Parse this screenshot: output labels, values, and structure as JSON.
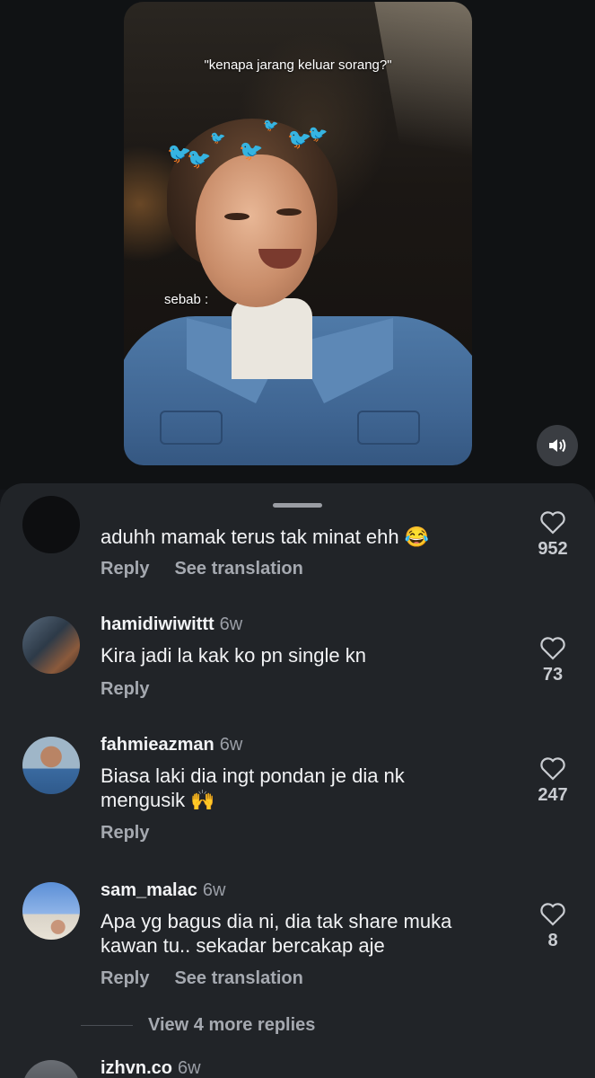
{
  "video": {
    "caption_top": "\"kenapa jarang keluar sorang?\"",
    "caption_mid": "sebab :",
    "mute_icon": "speaker-volume-icon"
  },
  "comments_sheet": {
    "comments": [
      {
        "text": "aduhh mamak terus tak minat ehh 😂",
        "reply_label": "Reply",
        "translate_label": "See translation",
        "likes": "952"
      },
      {
        "username": "hamidiwiwittt",
        "time": "6w",
        "text": "Kira jadi la kak ko pn single kn",
        "reply_label": "Reply",
        "likes": "73"
      },
      {
        "username": "fahmieazman",
        "time": "6w",
        "text": "Biasa laki dia ingt pondan je dia nk mengusik 🙌",
        "reply_label": "Reply",
        "likes": "247"
      },
      {
        "username": "sam_malac",
        "time": "6w",
        "text": "Apa yg bagus dia ni, dia tak share muka kawan tu.. sekadar bercakap aje",
        "reply_label": "Reply",
        "translate_label": "See translation",
        "likes": "8"
      },
      {
        "username": "izhvn.co",
        "time": "6w"
      }
    ],
    "view_more_replies": "View 4 more replies"
  },
  "colors": {
    "sheet_bg": "#212428",
    "page_bg": "#101214",
    "accent_text": "#f2f3f5",
    "muted_text": "#a5a9b0"
  }
}
